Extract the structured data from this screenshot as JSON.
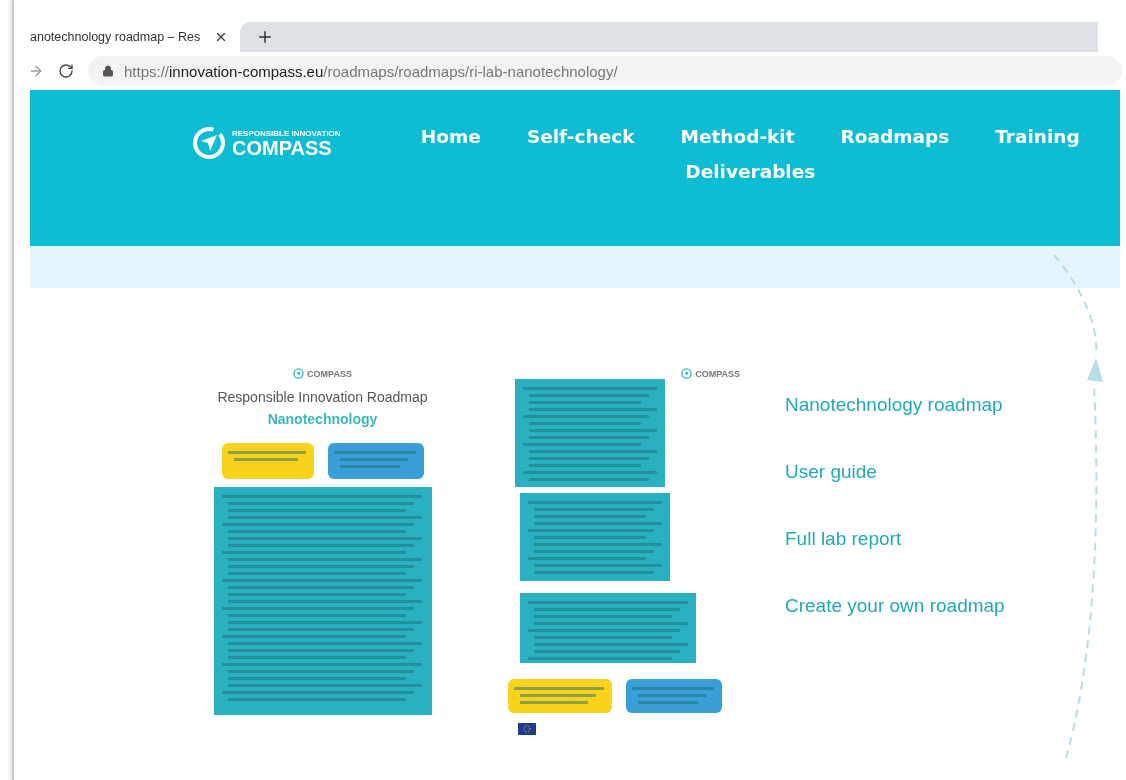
{
  "browser": {
    "tab": {
      "title": "anotechnology roadmap – Res",
      "selected": true
    },
    "url": {
      "scheme": "https://",
      "host": "innovation-compass.eu",
      "path": "/roadmaps/roadmaps/ri-lab-nanotechnology/"
    }
  },
  "header": {
    "logo": {
      "tagline": "RESPONSIBLE INNOVATION",
      "name": "COMPASS"
    },
    "nav": [
      "Home",
      "Self-check",
      "Method-kit",
      "Roadmaps",
      "Training",
      "Deliverables"
    ]
  },
  "roadmap_preview": {
    "page_1": {
      "logo": "COMPASS",
      "title": "Responsible Innovation Roadmap",
      "subtitle": "Nanotechnology"
    },
    "page_2": {
      "logo": "COMPASS"
    }
  },
  "links": [
    "Nanotechnology roadmap",
    "User guide",
    "Full lab report",
    "Create your own roadmap"
  ]
}
